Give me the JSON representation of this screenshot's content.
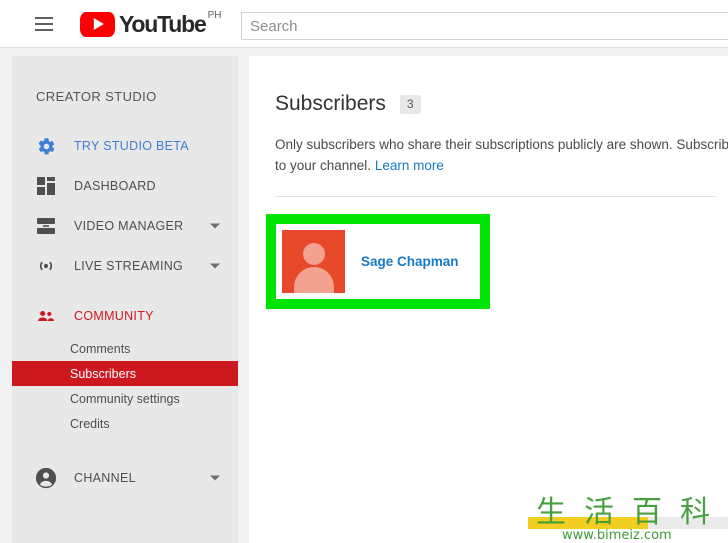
{
  "topbar": {
    "menu_icon": "hamburger-icon",
    "logo_text": "YouTube",
    "logo_country": "PH",
    "search_placeholder": "Search",
    "search_value": ""
  },
  "sidebar": {
    "title": "CREATOR STUDIO",
    "items": [
      {
        "label": "TRY STUDIO BETA",
        "icon": "gear-icon",
        "chevron": false
      },
      {
        "label": "DASHBOARD",
        "icon": "dashboard-icon",
        "chevron": false
      },
      {
        "label": "VIDEO MANAGER",
        "icon": "video-manager-icon",
        "chevron": true
      },
      {
        "label": "LIVE STREAMING",
        "icon": "live-streaming-icon",
        "chevron": true
      },
      {
        "label": "COMMUNITY",
        "icon": "community-people-icon",
        "chevron": false
      }
    ],
    "subitems": [
      {
        "label": "Comments",
        "active": false
      },
      {
        "label": "Subscribers",
        "active": true
      },
      {
        "label": "Community settings",
        "active": false
      },
      {
        "label": "Credits",
        "active": false
      }
    ],
    "channel": {
      "label": "CHANNEL",
      "icon": "account-circle-icon",
      "chevron": true
    }
  },
  "main": {
    "title": "Subscribers",
    "count": "3",
    "description_line1": "Only subscribers who share their subscriptions publicly are shown. Subscrib",
    "description_line2_prefix": "to your channel. ",
    "description_link": "Learn more",
    "subscriber": {
      "name": "Sage Chapman",
      "avatar_icon": "person-avatar-icon"
    }
  },
  "watermark": {
    "chars": "生活百科",
    "url": "www.bimeiz.com"
  },
  "colors": {
    "brand_red": "#ff0000",
    "link_blue": "#167ac6",
    "active_red": "#cc181e",
    "highlight_green": "#00e500",
    "avatar_orange": "#e8492a"
  }
}
